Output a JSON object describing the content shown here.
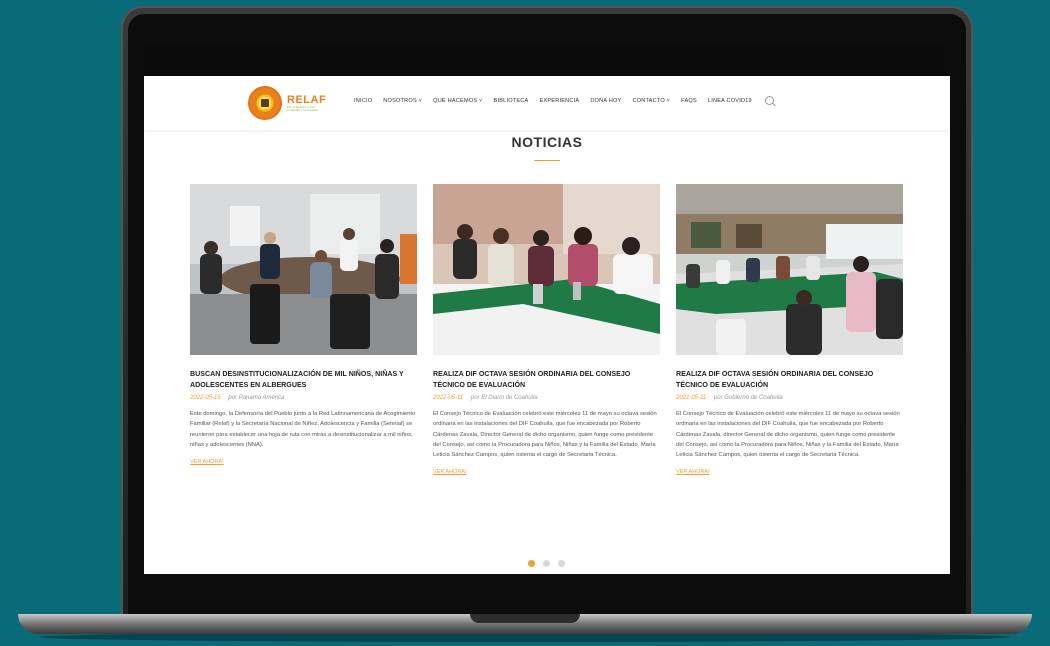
{
  "header": {
    "logo": {
      "name": "RELAF",
      "tagline": "Por el derecho a vivir en familia y comunidad"
    },
    "nav": [
      "INICIO",
      "NOSOTROS ˅",
      "QUÉ HACEMOS ˅",
      "BIBLIOTECA",
      "EXPERIENCIA",
      "DONA HOY",
      "CONTACTO ˅",
      "FAQS",
      "LINEA COVID19"
    ]
  },
  "section": {
    "title": "NOTICIAS"
  },
  "cards": [
    {
      "title": "BUSCAN DESINSTITUCIONALIZACIÓN DE MIL NIÑOS, NIÑAS Y ADOLESCENTES EN ALBERGUES",
      "date": "2022-05-15",
      "author": "por Panamá América",
      "excerpt": "Este domingo, la Defensoría del Pueblo junto a la Red Latinoamericana de Acogimiento Familiar (Relaf) y la Secretaría Nacional de Niñez, Adolescencia y Familia (Senniaf) se reunieron para establecer una hoja de ruta con miras a desinstitucionalizar a mil niños, niñas y adolescentes (NNA).",
      "link": "VER AHORA!"
    },
    {
      "title": "REALIZA DIF OCTAVA SESIÓN ORDINARIA DEL CONSEJO TÉCNICO DE EVALUACIÓN",
      "date": "2022-05-11",
      "author": "por El Diario de Coahuila",
      "excerpt": "El Consejo Técnico de Evaluación celebró este miércoles 11 de mayo su octava sesión ordinaria en las instalaciones del DIF Coahuila, que fue encabezada por Roberto Cárdenas Zavala, Director General de dicho organismo, quien funge como presidente del Consejo, así como la Procuradora para Niños, Niñas y la Familia del Estado, María Leticia Sánchez Campos, quien ostenta el cargo de Secretaria Técnica.",
      "link": "VER AHORA!"
    },
    {
      "title": "REALIZA DIF OCTAVA SESIÓN ORDINARIA DEL CONSEJO TÉCNICO DE EVALUACIÓN",
      "date": "2022-05-11",
      "author": "por Gobierno de Coahuila",
      "excerpt": "El Consejo Técnico de Evaluación celebró este miércoles 11 de mayo su octava sesión ordinaria en las instalaciones del DIF Coahuila, que fue encabezada por Roberto Cárdenas Zavala, director General de dicho organismo, quien funge como presidente del Consejo, así como la Procuradora para Niños, Niñas y la Familia del Estado, María Leticia Sánchez Campos, quien ostenta el cargo de Secretaria Técnica.",
      "link": "VER AHORA!"
    }
  ],
  "carousel": {
    "pages": 3,
    "active": 1
  },
  "colors": {
    "accent": "#f0a030",
    "background": "#0a6b78",
    "logo_orange": "#e8811c"
  }
}
